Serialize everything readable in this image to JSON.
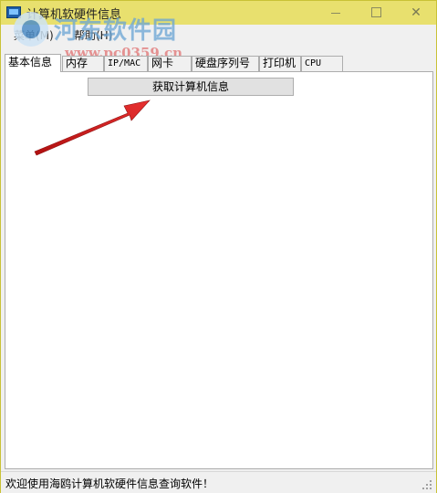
{
  "window": {
    "title": "计算机软硬件信息"
  },
  "menu": {
    "items": [
      {
        "label": "菜单(M)"
      },
      {
        "label": "帮助(H)"
      }
    ]
  },
  "watermark": {
    "name": "河东软件园",
    "url": "www.pc0359.cn"
  },
  "tabs": [
    {
      "label": "基本信息",
      "active": true
    },
    {
      "label": "内存"
    },
    {
      "label": "IP/MAC"
    },
    {
      "label": "网卡"
    },
    {
      "label": "硬盘序列号"
    },
    {
      "label": "打印机"
    },
    {
      "label": "CPU"
    }
  ],
  "panel": {
    "get_button_label": "获取计算机信息"
  },
  "status": {
    "text": "欢迎使用海鸥计算机软硬件信息查询软件！"
  },
  "colors": {
    "titlebar": "#e8e06e",
    "arrow": "#d42020",
    "button_bg": "#e1e1e1"
  },
  "icons": {
    "app": "monitor-icon",
    "minimize": "minimize-icon",
    "maximize": "maximize-icon",
    "close": "close-icon",
    "grip": "resize-grip-icon"
  }
}
